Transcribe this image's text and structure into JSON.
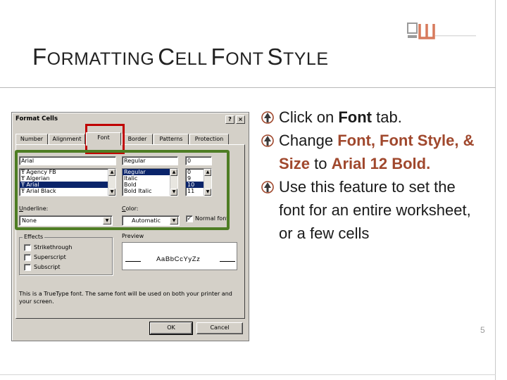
{
  "slide": {
    "title_parts": [
      {
        "cap": "F",
        "rest": "ORMATTING"
      },
      {
        "cap": "C",
        "rest": "ELL"
      },
      {
        "cap": "F",
        "rest": "ONT"
      },
      {
        "cap": "S",
        "rest": "TYLE"
      }
    ],
    "colors": {
      "accent": "#a0482d",
      "title": "#222222",
      "red_box": "#c00000",
      "green_box": "#4e7d24"
    },
    "logo_icon": "institution-logo-icon",
    "bullet_icon": "pointer-bullet-icon",
    "page_mark": "5"
  },
  "bullets": [
    {
      "segments": [
        {
          "t": "Click on ",
          "s": "normal"
        },
        {
          "t": "Font",
          "s": "bold"
        },
        {
          "t": " tab.",
          "s": "normal"
        }
      ]
    },
    {
      "segments": [
        {
          "t": "Change ",
          "s": "normal"
        },
        {
          "t": "Font, Font Style, & Size",
          "s": "accent"
        },
        {
          "t": " to ",
          "s": "normal"
        },
        {
          "t": "Arial 12 Bold.",
          "s": "accent"
        }
      ]
    },
    {
      "segments": [
        {
          "t": "Use this feature to set the font for an entire worksheet, or a few cells",
          "s": "normal"
        }
      ]
    }
  ],
  "dialog": {
    "title": "Format Cells",
    "help_button": "?",
    "close_button": "×",
    "tabs": [
      "Number",
      "Alignment",
      "Font",
      "Border",
      "Patterns",
      "Protection"
    ],
    "active_tab": "Font",
    "font": {
      "value": "Arial",
      "items": [
        "Agency FB",
        "Algerian",
        "Arial",
        "Arial Black"
      ],
      "selected": "Arial"
    },
    "font_style": {
      "value": "Regular",
      "items": [
        "Regular",
        "Italic",
        "Bold",
        "Bold Italic"
      ],
      "selected": "Regular"
    },
    "size": {
      "value": "0",
      "items": [
        "0",
        "9",
        "10",
        "11"
      ],
      "selected": "10"
    },
    "underline": {
      "label_pre": "",
      "label_u": "U",
      "label_post": "nderline:",
      "value": "None"
    },
    "color": {
      "label_pre": "",
      "label_u": "C",
      "label_post": "olor:",
      "value": "Automatic"
    },
    "normal_font": {
      "label": "Normal font",
      "checked": true
    },
    "effects": {
      "label": "Effects",
      "items": [
        "Strikethrough",
        "Superscript",
        "Subscript"
      ]
    },
    "preview": {
      "label": "Preview",
      "sample": "AaBbCcYyZz"
    },
    "footnote": "This is a TrueType font. The same font will be used on both your printer and your screen.",
    "ok": "OK",
    "cancel": "Cancel"
  }
}
